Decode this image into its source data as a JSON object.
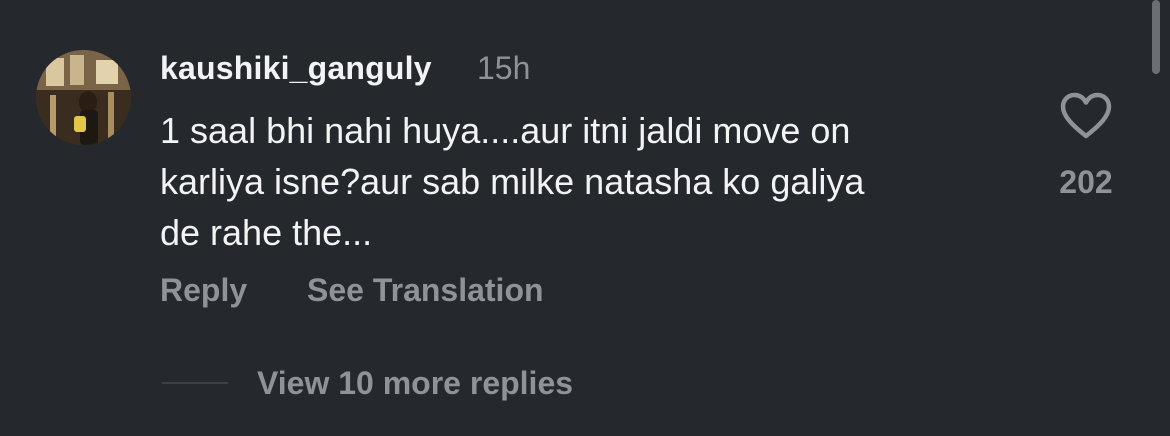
{
  "comment": {
    "username": "kaushiki_ganguly",
    "time": "15h",
    "text_lines": [
      "1 saal bhi nahi huya....aur itni jaldi move on",
      "karliya isne?aur sab milke natasha ko galiya",
      "de rahe the..."
    ],
    "like_icon": "heart-outline-icon",
    "like_count": "202"
  },
  "actions": {
    "reply_label": "Reply",
    "translate_label": "See Translation"
  },
  "replies": {
    "view_more_label": "View 10 more replies"
  },
  "colors": {
    "background": "#25282c",
    "primary_text": "#f2f3f5",
    "secondary_text": "#8e9399"
  }
}
